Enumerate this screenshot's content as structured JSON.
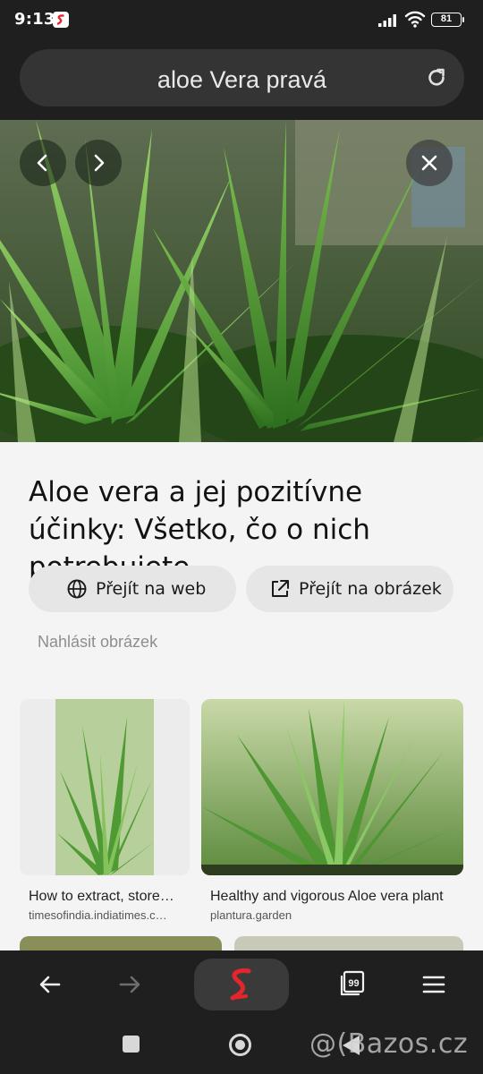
{
  "status_bar": {
    "time": "9:13",
    "battery": "81",
    "icons": [
      "app-notification-icon",
      "signal-icon",
      "wifi-icon",
      "battery-icon"
    ]
  },
  "address_bar": {
    "query": "aloe Vera pravá",
    "icons": [
      "reload-icon"
    ]
  },
  "viewer": {
    "icons": [
      "chevron-left-icon",
      "chevron-right-icon",
      "close-icon"
    ],
    "title": "Aloe vera a jej pozitívne účinky: Všetko, čo o nich potrebujete…",
    "visit_web_label": "Přejít na web",
    "visit_image_label": "Přejít na obrázek",
    "report_label": "Nahlásit obrázek"
  },
  "related": [
    {
      "title": "How to extract, store…",
      "source": "timesofindia.indiatimes.c…"
    },
    {
      "title": "Healthy and vigorous Aloe vera plant",
      "source": "plantura.garden"
    }
  ],
  "toolbar": {
    "icons": [
      "back-arrow-icon",
      "forward-arrow-icon",
      "app-logo-icon",
      "tabs-icon",
      "menu-icon"
    ],
    "tabs_count": "99"
  },
  "system_nav": {
    "icons": [
      "recents-icon",
      "home-icon",
      "back-icon"
    ]
  },
  "watermark": "@(Bazos.cz",
  "colors": {
    "dark_chrome": "#1f1f1f",
    "address_bar": "#343434",
    "panel": "#f4f4f4",
    "button_bg": "#e6e6e6",
    "brand_red": "#e3262b"
  }
}
